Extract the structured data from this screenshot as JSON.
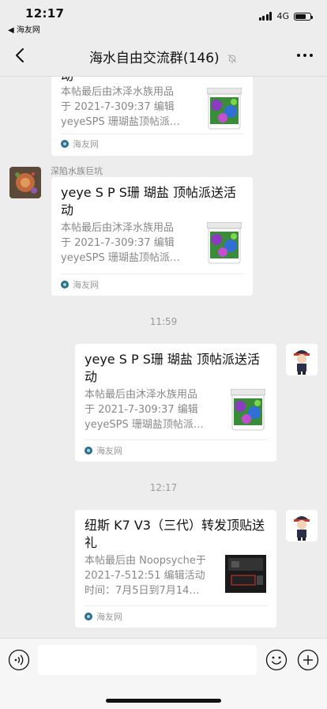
{
  "status": {
    "time": "12:17",
    "back_app": "◀ 海友网",
    "network": "4G",
    "battery_level": 0.7
  },
  "nav": {
    "title": "海水自由交流群(146)",
    "mute_icon": "bell-slash-icon"
  },
  "messages": {
    "m1": {
      "title_tail": "动",
      "desc": [
        "本帖最后由沐泽水族用品",
        "于 2021-7-309:37 编辑",
        "yeyeSPS 珊瑚盐顶帖派…"
      ],
      "source": "海友网"
    },
    "m2": {
      "sender": "深陷水族巨坑",
      "title": "yeye S P S珊 瑚盐 顶帖派送活动",
      "desc": [
        "本帖最后由沐泽水族用品",
        "于 2021-7-309:37 编辑",
        "yeyeSPS 珊瑚盐顶帖派…"
      ],
      "source": "海友网"
    },
    "t1": "11:59",
    "m3": {
      "title": "yeye S P S珊 瑚盐 顶帖派送活动",
      "desc": [
        "本帖最后由沐泽水族用品",
        "于 2021-7-309:37 编辑",
        "yeyeSPS 珊瑚盐顶帖派…"
      ],
      "source": "海友网"
    },
    "t2": "12:17",
    "m4": {
      "title": "纽斯 K7 V3（三代）转发顶贴送礼",
      "desc": [
        "本帖最后由 Noopsyche于",
        "2021-7-512:51 编辑活动",
        "时间：7月5日到7月14…"
      ],
      "source": "海友网"
    }
  },
  "input": {
    "placeholder": ""
  },
  "colors": {
    "background": "#ededed",
    "card": "#ffffff",
    "secondary_text": "#888888"
  }
}
